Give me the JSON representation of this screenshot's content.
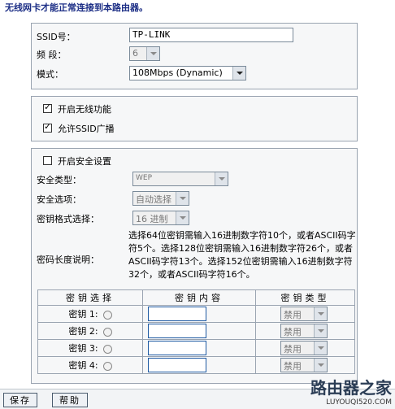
{
  "notice": "无线网卡才能正常连接到本路由器。",
  "basic": {
    "ssid_label": "SSID号：",
    "ssid_value": "TP-LINK",
    "channel_label": "频  段：",
    "channel_value": "6",
    "mode_label": "模式：",
    "mode_value": "108Mbps (Dynamic)"
  },
  "wireless": {
    "enable_wireless": "开启无线功能",
    "enable_wireless_checked": true,
    "allow_ssid_broadcast": "允许SSID广播",
    "allow_ssid_broadcast_checked": true
  },
  "security": {
    "enable_security": "开启安全设置",
    "enable_security_checked": false,
    "type_label": "安全类型：",
    "type_value": "WEP",
    "option_label": "安全选项：",
    "option_value": "自动选择",
    "key_format_label": "密钥格式选择：",
    "key_format_value": "16 进制",
    "key_length_label": "密码长度说明：",
    "key_length_desc": "选择64位密钥需输入16进制数字符10个，或者ASCII码字符5个。选择128位密钥需输入16进制数字符26个，或者ASCII码字符13个。选择152位密钥需输入16进制数字符32个，或者ASCII码字符16个。"
  },
  "keys_table": {
    "headers": [
      "密钥选择",
      "密钥内容",
      "密钥类型"
    ],
    "rows": [
      {
        "label": "密钥 1:",
        "type": "禁用"
      },
      {
        "label": "密钥 2:",
        "type": "禁用"
      },
      {
        "label": "密钥 3:",
        "type": "禁用"
      },
      {
        "label": "密钥 4:",
        "type": "禁用"
      }
    ]
  },
  "buttons": {
    "save": "保存",
    "help": "帮助"
  },
  "watermark": {
    "title": "路由器之家",
    "url": "LUYOUQI520.COM"
  }
}
